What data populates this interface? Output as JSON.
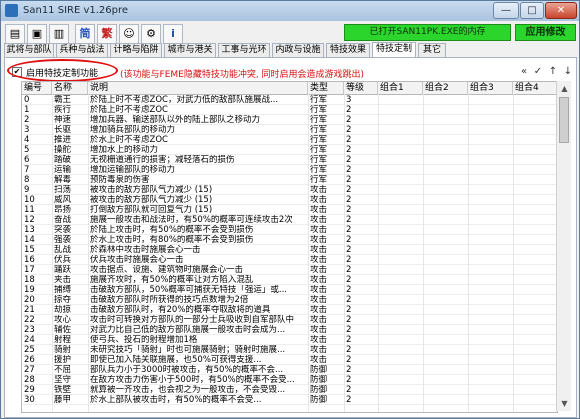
{
  "window": {
    "title": "San11 SIRE v1.26pre",
    "min_label": "—",
    "max_label": "□",
    "close_label": "✕"
  },
  "toolbar": {
    "buttons": [
      {
        "icon": "open-folder-icon",
        "glyph": "▤"
      },
      {
        "icon": "save-icon",
        "glyph": "▣"
      },
      {
        "icon": "export-icon",
        "glyph": "▥"
      },
      {
        "icon": "simplified-text",
        "label": "简"
      },
      {
        "icon": "traditional-text",
        "label": "繁"
      },
      {
        "icon": "character-icon",
        "glyph": "☺"
      },
      {
        "icon": "settings-icon",
        "glyph": "⚙"
      },
      {
        "icon": "about-icon",
        "glyph": "i"
      }
    ]
  },
  "status": {
    "text": "已打开SAN11PK.EXE的内存",
    "apply_label": "应用修改"
  },
  "tabs": [
    "武将与部队",
    "兵种与战法",
    "计略与陷阱",
    "城市与港关",
    "工事与光环",
    "内政与设施",
    "特技效果",
    "特技定制",
    "其它"
  ],
  "active_tab": 7,
  "toggle": {
    "checked": true,
    "label": "启用特技定制功能",
    "warning": "(该功能与FEME隐藏特技功能冲突, 同时启用会造成游戏跳出)"
  },
  "tools": [
    "«",
    "✓",
    "↑",
    "↓"
  ],
  "table": {
    "columns": [
      "编号",
      "名称",
      "说明",
      "类型",
      "等级",
      "组合1",
      "组合2",
      "组合3",
      "组合4"
    ],
    "rows": [
      [
        "0",
        "霸王",
        "於陆上时不考虑ZOC，对武力低的敌部队施展战...",
        "行军",
        "3",
        "",
        "",
        "",
        ""
      ],
      [
        "1",
        "疾行",
        "於陆上时不考虑ZOC",
        "行军",
        "2",
        "",
        "",
        "",
        ""
      ],
      [
        "2",
        "神速",
        "增加兵器、输送部队以外的陆上部队之移动力",
        "行军",
        "2",
        "",
        "",
        "",
        ""
      ],
      [
        "3",
        "长驱",
        "增加骑兵部队的移动力",
        "行军",
        "2",
        "",
        "",
        "",
        ""
      ],
      [
        "4",
        "推进",
        "於水上时不考虑ZOC",
        "行军",
        "2",
        "",
        "",
        "",
        ""
      ],
      [
        "5",
        "操舵",
        "增加水上的移动力",
        "行军",
        "2",
        "",
        "",
        "",
        ""
      ],
      [
        "6",
        "踏破",
        "无视栅道通行的损害；减轻落石的损伤",
        "行军",
        "2",
        "",
        "",
        "",
        ""
      ],
      [
        "7",
        "运输",
        "增加运输部队的移动力",
        "行军",
        "2",
        "",
        "",
        "",
        ""
      ],
      [
        "8",
        "解毒",
        "预防毒泉的伤害",
        "行军",
        "2",
        "",
        "",
        "",
        ""
      ],
      [
        "9",
        "扫荡",
        "被攻击的敌方部队气力减少 (15)",
        "攻击",
        "2",
        "",
        "",
        "",
        ""
      ],
      [
        "10",
        "威风",
        "被攻击的敌方部队气力减少 (15)",
        "攻击",
        "2",
        "",
        "",
        "",
        ""
      ],
      [
        "11",
        "昂扬",
        "打倒敌方部队就可回复气力 (15)",
        "攻击",
        "2",
        "",
        "",
        "",
        ""
      ],
      [
        "12",
        "奋战",
        "施展一般攻击和战法时，有50%的概率可连续攻击2次",
        "攻击",
        "2",
        "",
        "",
        "",
        ""
      ],
      [
        "13",
        "突袭",
        "於陆上攻击时，有50%的概率不会受到损伤",
        "攻击",
        "2",
        "",
        "",
        "",
        ""
      ],
      [
        "14",
        "强袭",
        "於水上攻击时，有80%的概率不会受到损伤",
        "攻击",
        "2",
        "",
        "",
        "",
        ""
      ],
      [
        "15",
        "乱战",
        "於森林中攻击时施展会心一击",
        "攻击",
        "2",
        "",
        "",
        "",
        ""
      ],
      [
        "16",
        "伏兵",
        "伏兵攻击时施展会心一击",
        "攻击",
        "2",
        "",
        "",
        "",
        ""
      ],
      [
        "17",
        "踊跃",
        "攻击据点、设施、建筑物时施展会心一击",
        "攻击",
        "2",
        "",
        "",
        "",
        ""
      ],
      [
        "18",
        "夹击",
        "施展齐攻时，有50%的概率让对方陷入混乱",
        "攻击",
        "2",
        "",
        "",
        "",
        ""
      ],
      [
        "19",
        "捕缚",
        "击破敌方部队，50%概率可捕获无特技「强运」或...",
        "攻击",
        "2",
        "",
        "",
        "",
        ""
      ],
      [
        "20",
        "掠夺",
        "击破敌方部队时所获得的技巧点数增为2倍",
        "攻击",
        "2",
        "",
        "",
        "",
        ""
      ],
      [
        "21",
        "劫掠",
        "击破敌方部队时，有20%的概率夺取敌将的道具",
        "攻击",
        "2",
        "",
        "",
        "",
        ""
      ],
      [
        "22",
        "攻心",
        "攻击时可转换对方部队的一部分士兵吸收到自军部队中",
        "攻击",
        "2",
        "",
        "",
        "",
        ""
      ],
      [
        "23",
        "辅佐",
        "对武力比自己低的敌方部队施展一般攻击时会成为...",
        "攻击",
        "2",
        "",
        "",
        "",
        ""
      ],
      [
        "24",
        "射程",
        "使弓兵、投石的射程增加1格",
        "攻击",
        "2",
        "",
        "",
        "",
        ""
      ],
      [
        "25",
        "骑射",
        "未研究技巧「骑射」时也可施展骑射；骑射时施展...",
        "攻击",
        "2",
        "",
        "",
        "",
        ""
      ],
      [
        "26",
        "援护",
        "即使已加入陆关联施展，也50%可获得支援...",
        "攻击",
        "2",
        "",
        "",
        "",
        ""
      ],
      [
        "27",
        "不屈",
        "部队兵力小于3000时被攻击，有50%的概率不会...",
        "防御",
        "2",
        "",
        "",
        "",
        ""
      ],
      [
        "28",
        "坚守",
        "在敌方攻击力伤害小于500时，有50%的概率不会受...",
        "防御",
        "2",
        "",
        "",
        "",
        ""
      ],
      [
        "29",
        "铁壁",
        "就算被一齐攻击，也会视之为一般攻击，不会受毁...",
        "防御",
        "2",
        "",
        "",
        "",
        ""
      ],
      [
        "30",
        "藤甲",
        "於水上部队被攻击时，有50%的概率不会受...",
        "防御",
        "2",
        "",
        "",
        "",
        ""
      ]
    ]
  }
}
